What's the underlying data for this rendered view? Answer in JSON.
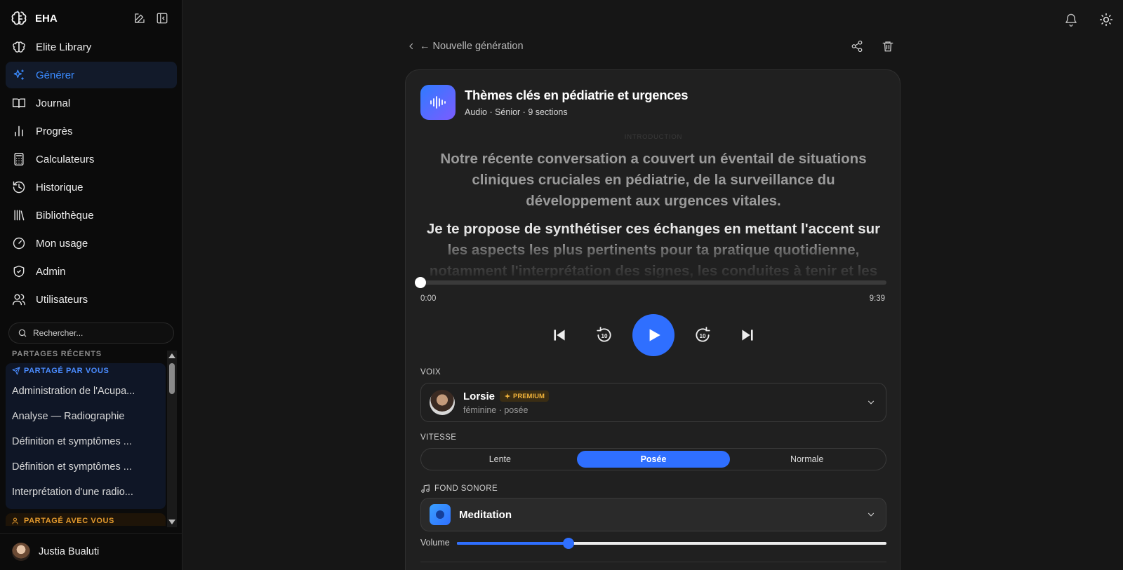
{
  "sidebar": {
    "brand": "EHA",
    "nav": [
      {
        "label": "Elite Library",
        "icon": "brain-icon"
      },
      {
        "label": "Générer",
        "icon": "sparkles-icon",
        "active": true
      },
      {
        "label": "Journal",
        "icon": "book-open-icon"
      },
      {
        "label": "Progrès",
        "icon": "bar-chart-icon"
      },
      {
        "label": "Calculateurs",
        "icon": "calculator-icon"
      },
      {
        "label": "Historique",
        "icon": "history-icon"
      },
      {
        "label": "Bibliothèque",
        "icon": "library-icon"
      },
      {
        "label": "Mon usage",
        "icon": "gauge-icon"
      },
      {
        "label": "Admin",
        "icon": "shield-icon"
      },
      {
        "label": "Utilisateurs",
        "icon": "users-icon"
      }
    ],
    "search_placeholder": "Rechercher...",
    "recent_label": "PARTAGES RÉCENTS",
    "shared_by_you": {
      "title": "PARTAGÉ PAR VOUS",
      "items": [
        "Administration de l'Acupa...",
        "Analyse — Radiographie",
        "Définition et symptômes ...",
        "Définition et symptômes ...",
        "Interprétation d'une radio..."
      ]
    },
    "shared_with_you": {
      "title": "PARTAGÉ AVEC VOUS"
    },
    "user_name": "Justia Bualuti"
  },
  "crumb": {
    "label": "← Nouvelle génération"
  },
  "card": {
    "title": "Thèmes clés en pédiatrie et urgences",
    "subtitle": "Audio · Sénior · 9 sections",
    "section_tag": "INTRODUCTION",
    "paragraph1": "Notre récente conversation a couvert un éventail de situations cliniques cruciales en pédiatrie, de la surveillance du développement aux urgences vitales.",
    "paragraph2": "Je te propose de synthétiser ces échanges en mettant l'accent sur les aspects les plus pertinents pour ta pratique quotidienne, notamment l'interprétation des signes, les conduites à tenir et les raisonnements",
    "progress": 0,
    "time_current": "0:00",
    "time_total": "9:39",
    "voice_label": "VOIX",
    "voice": {
      "name": "Lorsie",
      "badge": "PREMIUM",
      "sub": "féminine · posée"
    },
    "speed_label": "VITESSE",
    "speed_options": [
      "Lente",
      "Posée",
      "Normale"
    ],
    "speed_selected": "Posée",
    "sound_label": "FOND SONORE",
    "sound_name": "Meditation",
    "volume_label": "Volume",
    "volume": 0.26
  },
  "colors": {
    "accent": "#2f6fff",
    "premium": "#f0b23a",
    "shared_with": "#e39a2d"
  }
}
